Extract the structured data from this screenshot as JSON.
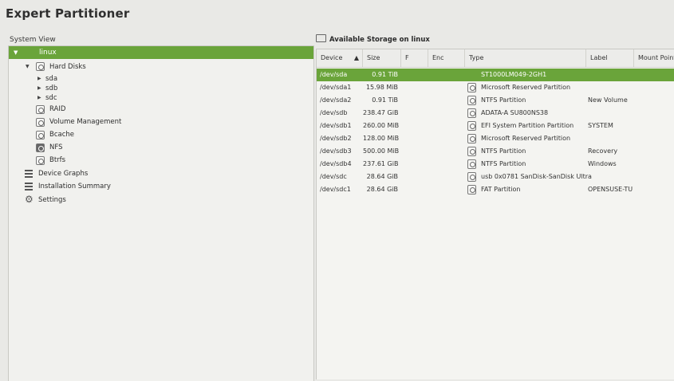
{
  "window": {
    "title": "Expert Partitioner"
  },
  "left_panel": {
    "label": "System View",
    "root": "linux",
    "hard_disks": "Hard Disks",
    "disks": [
      "sda",
      "sdb",
      "sdc"
    ],
    "items": [
      "RAID",
      "Volume Management",
      "Bcache",
      "NFS",
      "Btrfs"
    ],
    "device_graphs": "Device Graphs",
    "installation_summary": "Installation Summary",
    "settings": "Settings"
  },
  "right_panel": {
    "heading": "Available Storage on linux",
    "columns": [
      "Device",
      "Size",
      "F",
      "Enc",
      "Type",
      "Label",
      "Mount Point"
    ],
    "rows": [
      {
        "device": "/dev/sda",
        "size": "0.91 TiB",
        "type": "ST1000LM049-2GH1",
        "label": "",
        "selected": true
      },
      {
        "device": "/dev/sda1",
        "size": "15.98 MiB",
        "type": "Microsoft Reserved Partition",
        "label": ""
      },
      {
        "device": "/dev/sda2",
        "size": "0.91 TiB",
        "type": "NTFS Partition",
        "label": "New Volume"
      },
      {
        "device": "/dev/sdb",
        "size": "238.47 GiB",
        "type": "ADATA-A SU800NS38",
        "label": ""
      },
      {
        "device": "/dev/sdb1",
        "size": "260.00 MiB",
        "type": "EFI System Partition Partition",
        "label": "SYSTEM"
      },
      {
        "device": "/dev/sdb2",
        "size": "128.00 MiB",
        "type": "Microsoft Reserved Partition",
        "label": ""
      },
      {
        "device": "/dev/sdb3",
        "size": "500.00 MiB",
        "type": "NTFS Partition",
        "label": "Recovery"
      },
      {
        "device": "/dev/sdb4",
        "size": "237.61 GiB",
        "type": "NTFS Partition",
        "label": "Windows"
      },
      {
        "device": "/dev/sdc",
        "size": "28.64 GiB",
        "type": "usb 0x0781 SanDisk-SanDisk Ultra",
        "label": ""
      },
      {
        "device": "/dev/sdc1",
        "size": "28.64 GiB",
        "type": "FAT Partition",
        "label": "OPENSUSE-TU"
      }
    ]
  },
  "colors": {
    "accent": "#6aa43a"
  }
}
